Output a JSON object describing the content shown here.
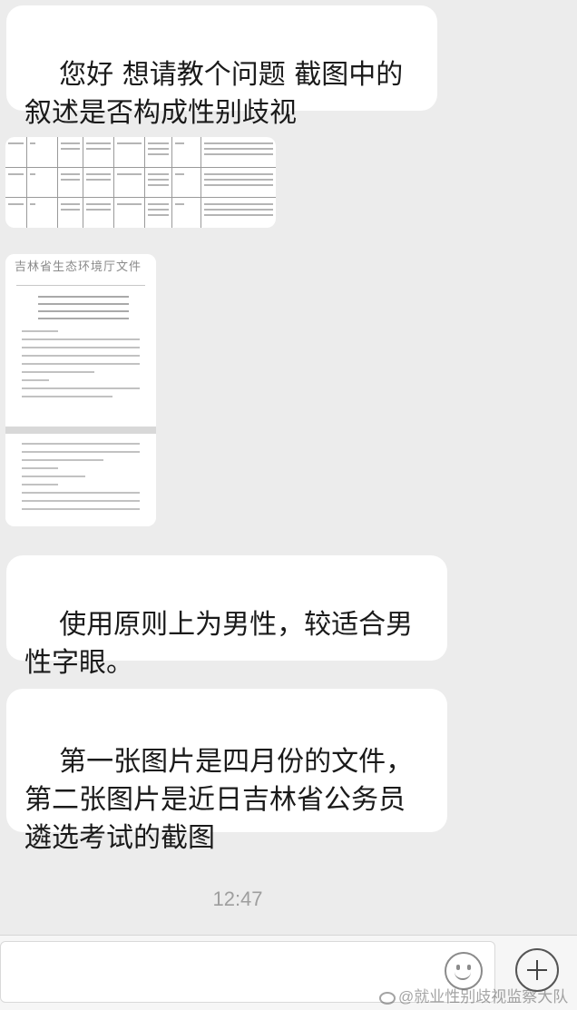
{
  "messages": [
    {
      "text": "您好 想请教个问题 截图中的叙述是否构成性别歧视"
    },
    {
      "text": "使用原则上为男性，较适合男性字眼。"
    },
    {
      "text": "第一张图片是四月份的文件，第二张图片是近日吉林省公务员遴选考试的截图"
    }
  ],
  "images": {
    "table_screenshot_icon": "table-screenshot",
    "document_header": "吉林省生态环境厅文件"
  },
  "timestamp": "12:47",
  "input_bar": {
    "emoji_icon": "emoji-icon",
    "add_icon": "plus-icon"
  },
  "watermark": "@就业性别歧视监察大队"
}
